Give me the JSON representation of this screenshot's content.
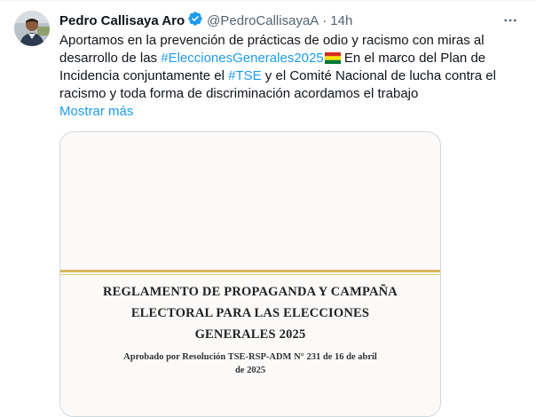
{
  "tweet": {
    "author_name": "Pedro Callisaya Aro",
    "handle": "@PedroCallisayaA",
    "separator": "·",
    "time": "14h",
    "more_icon": "more-horizontal-icon",
    "verified_icon": "verified-badge-icon",
    "text": {
      "part1": "Aportamos en la prevención de prácticas de odio y racismo con miras al desarrollo de las ",
      "hashtag1": "#EleccionesGenerales2025",
      "flag_icon": "bolivia-flag-emoji",
      "part2": "  En el marco del Plan de Incidencia conjuntamente el ",
      "hashtag2": "#TSE",
      "part3": " y el Comité Nacional de lucha contra el racismo y toda forma de discriminación acordamos el trabajo"
    },
    "show_more": "Mostrar más",
    "colors": {
      "link": "#1d9bf0",
      "secondary_text": "#536471",
      "verified": "#1d9bf0",
      "doc_rule": "#d9b65e"
    }
  },
  "document": {
    "title_line1": "REGLAMENTO DE PROPAGANDA Y CAMPAÑA",
    "title_line2": "ELECTORAL PARA LAS ELECCIONES",
    "title_line3": "GENERALES 2025",
    "subtitle_line1": "Aprobado por Resolución TSE-RSP-ADM N° 231 de 16 de abril",
    "subtitle_line2": "de 2025"
  }
}
